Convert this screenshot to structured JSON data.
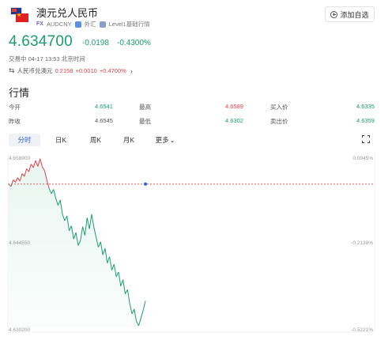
{
  "header": {
    "title": "澳元兑人民币",
    "code": "AUDCNY",
    "fx_tag": "FX",
    "market_tag": "外汇",
    "level_tag": "Level1基础行情",
    "watch_label": "添加自选"
  },
  "quote": {
    "price": "4.634700",
    "change": "-0.0198",
    "change_pct": "-0.4300%",
    "status": "交易中 04-17 13:53 北京时间"
  },
  "reverse": {
    "label": "人民币兑澳元",
    "price": "0.2158",
    "change": "+0.0010",
    "change_pct": "+0.4700%"
  },
  "section": {
    "title": "行情"
  },
  "stats": {
    "open_label": "今开",
    "open_value": "4.6541",
    "high_label": "最高",
    "high_value": "4.6589",
    "bid_label": "买入价",
    "bid_value": "4.6335",
    "prev_label": "昨收",
    "prev_value": "4.6545",
    "low_label": "最低",
    "low_value": "4.6302",
    "ask_label": "卖出价",
    "ask_value": "4.6359"
  },
  "tabs": [
    "分时",
    "日K",
    "周K",
    "月K",
    "更多"
  ],
  "active_tab": "分时",
  "colors": {
    "up": "#e0404a",
    "down": "#1a9e6a",
    "accent": "#2f5fd6"
  },
  "chart_data": {
    "type": "line",
    "y_labels_left": [
      "4.658900",
      "4.644550",
      "4.630200"
    ],
    "y_labels_right": [
      "0.0945%",
      "-0.2138%",
      "-0.5221%"
    ],
    "ylim": [
      4.6302,
      4.6589
    ],
    "prev_close": 4.6545,
    "series": [
      {
        "values": [
          4.6545,
          4.6541,
          4.6552,
          4.6548,
          4.6556,
          4.655,
          4.6563,
          4.6558,
          4.6571,
          4.6566,
          4.6579,
          4.6573,
          4.6585,
          4.6575,
          4.6588,
          4.6574,
          4.6568,
          4.6552,
          4.6538,
          4.6529,
          4.6536,
          4.6521,
          4.6509,
          4.6518,
          4.6494,
          4.6483,
          4.6491,
          4.6466,
          4.6474,
          4.6452,
          4.6463,
          4.6441,
          4.6449,
          4.6473,
          4.6458,
          4.6488,
          4.6469,
          4.6494,
          4.6472,
          4.6455,
          4.6438,
          4.6447,
          4.6425,
          4.6436,
          4.6411,
          4.6422,
          4.6399,
          4.6409,
          4.6388,
          4.6396,
          4.6372,
          4.6383,
          4.6359,
          4.6366,
          4.6343,
          4.6325,
          4.6333,
          4.6312,
          4.6305,
          4.6318,
          4.6331,
          4.6347
        ]
      }
    ]
  }
}
